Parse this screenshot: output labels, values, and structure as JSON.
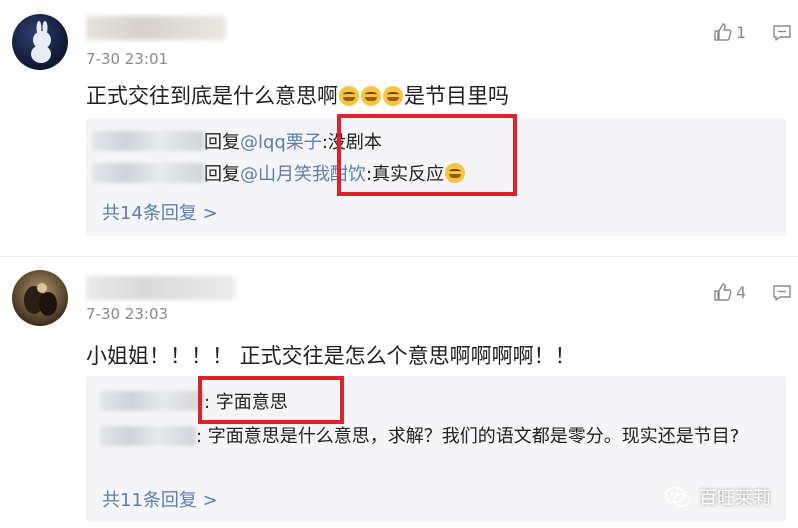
{
  "comments": [
    {
      "time": "7-30 23:01",
      "likes": "1",
      "text": "正式交往到底是什么意思啊",
      "text_suffix": "是节目里吗",
      "emoji": "laugh-cry-emoji",
      "replies": [
        {
          "verb": "回复",
          "mention": "@lqq栗子",
          "text": ":没剧本"
        },
        {
          "verb": "回复",
          "mention": "@山月笑我酣饮",
          "text": ":真实反应"
        }
      ],
      "more": "共14条回复 >"
    },
    {
      "time": "7-30 23:03",
      "likes": "4",
      "text": "小姐姐！！！！ 正式交往是怎么个意思啊啊啊啊！！",
      "replies": [
        {
          "text": ": 字面意思"
        },
        {
          "text": ": 字面意思是什么意思，求解？我们的语文都是零分。现实还是节目?"
        }
      ],
      "more": "共11条回复 >"
    }
  ],
  "watermark": "百旺莱莉",
  "colors": {
    "link": "#5b7fb0",
    "highlight": "#e0202a",
    "reply_bg": "#f5f5f7"
  }
}
